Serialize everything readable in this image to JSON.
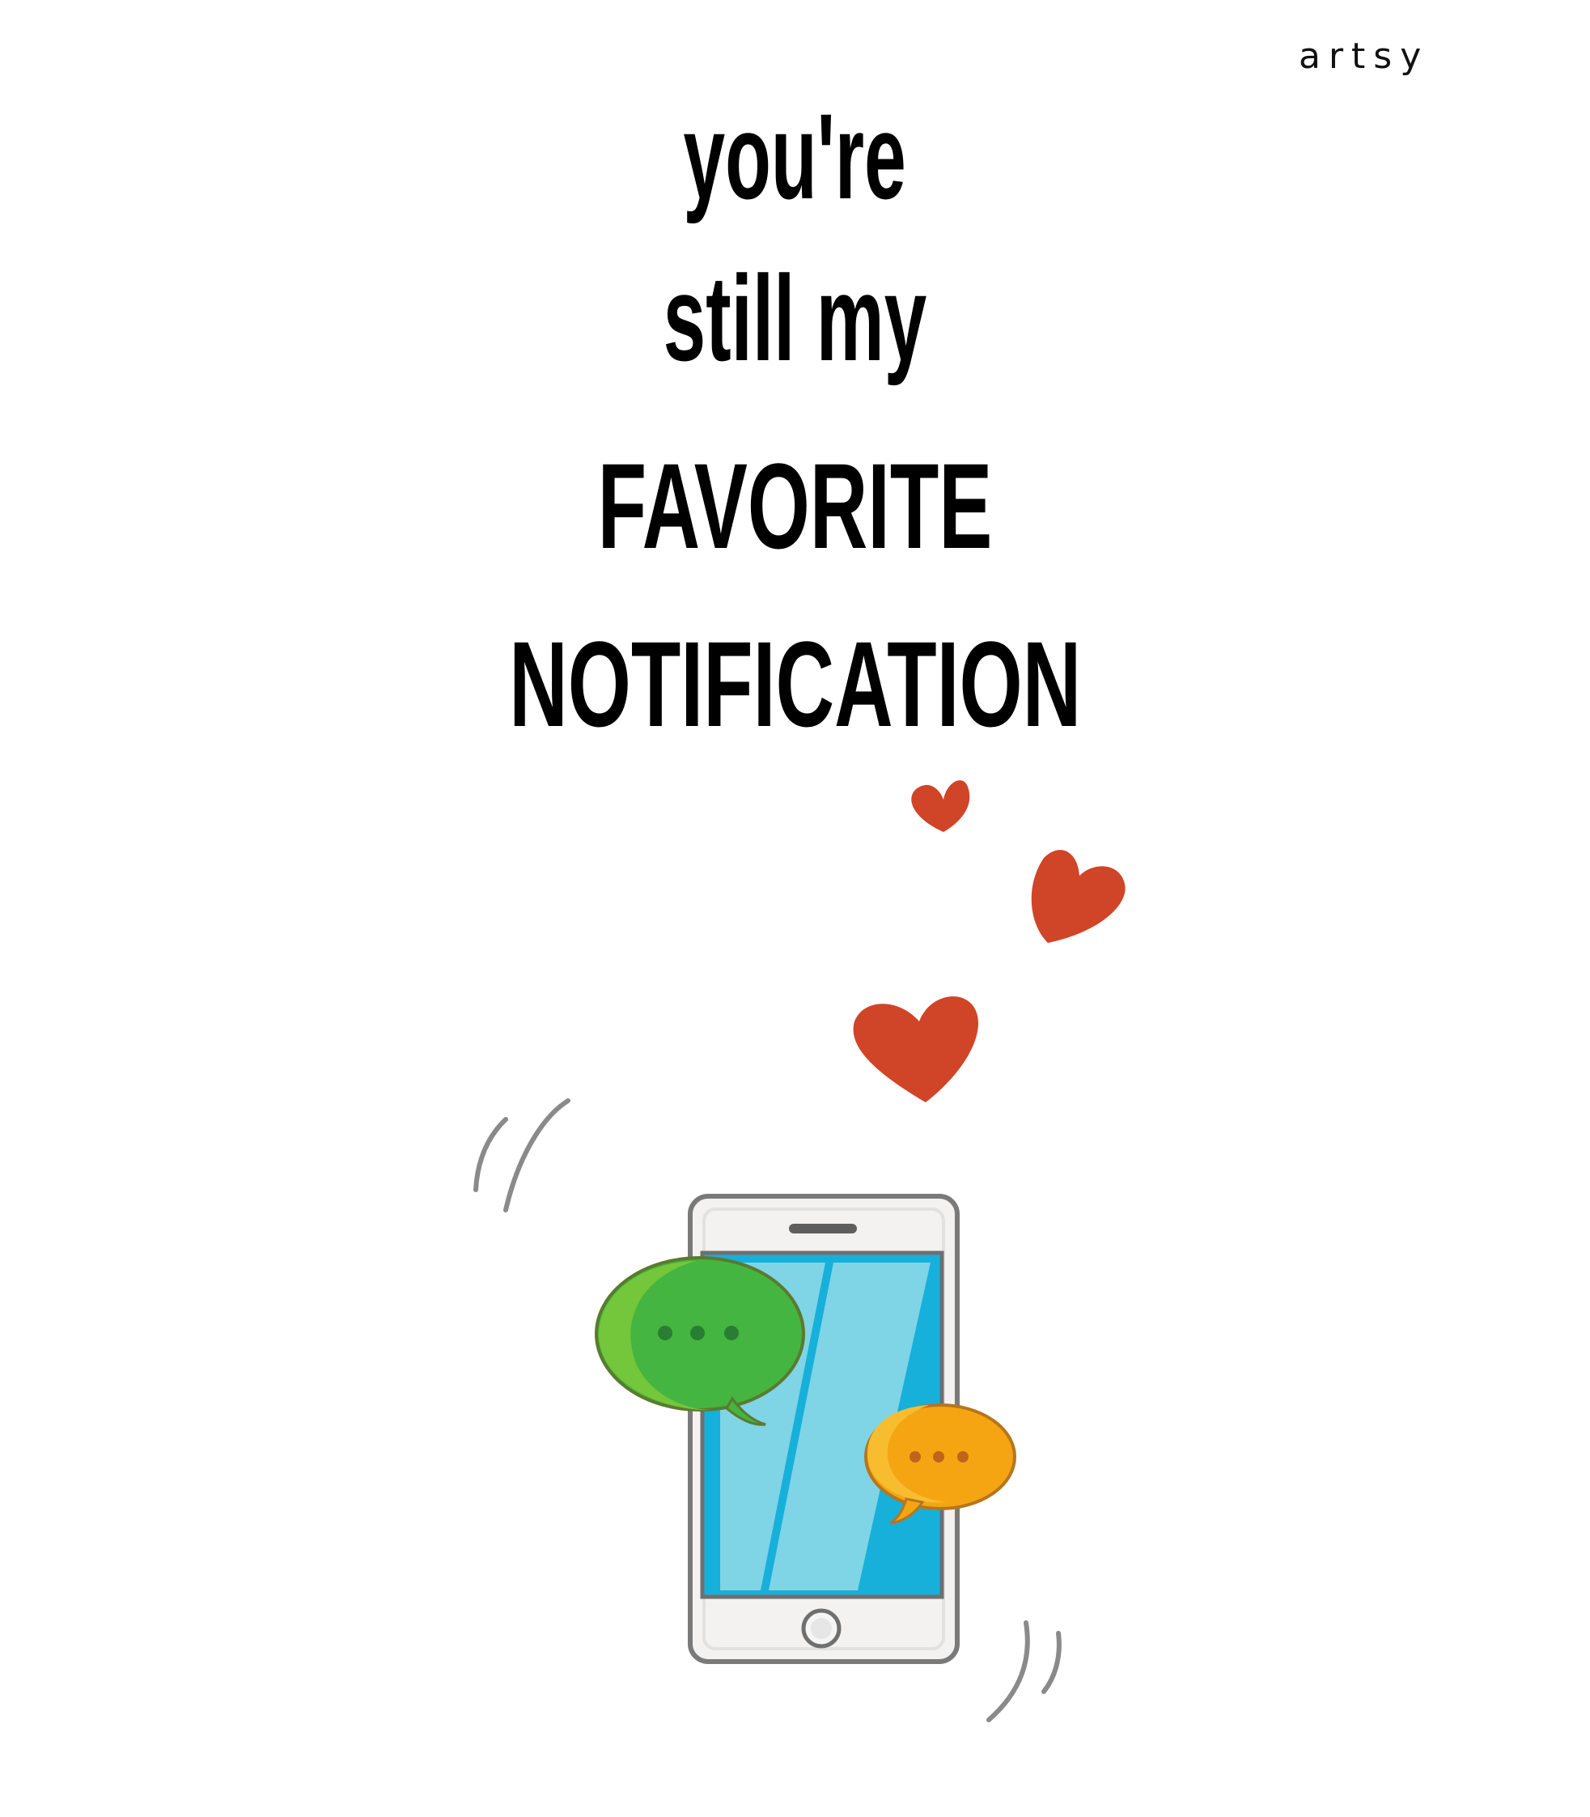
{
  "brand": {
    "name": "artsy"
  },
  "headline": {
    "line1": "you're",
    "line2": "still my",
    "line3": "FAVORITE",
    "line4": "NOTIFICATION"
  },
  "illustration": {
    "icons": [
      "heart-icon",
      "heart-icon",
      "heart-icon",
      "smartphone-icon",
      "chat-bubble-icon",
      "chat-bubble-icon",
      "vibration-lines-icon",
      "vibration-lines-icon"
    ],
    "colors": {
      "heart": "#d04428",
      "screen": "#7fd4e6",
      "screen_dark": "#16b0da",
      "phone_frame": "#f3f2f1",
      "phone_outline": "#7a7a7a",
      "bubble_green": "#44b540",
      "bubble_green_light": "#6cc63a",
      "bubble_orange": "#f5a512",
      "bubble_orange_light": "#f8bc2f",
      "vibration": "#8a8a8a"
    }
  }
}
